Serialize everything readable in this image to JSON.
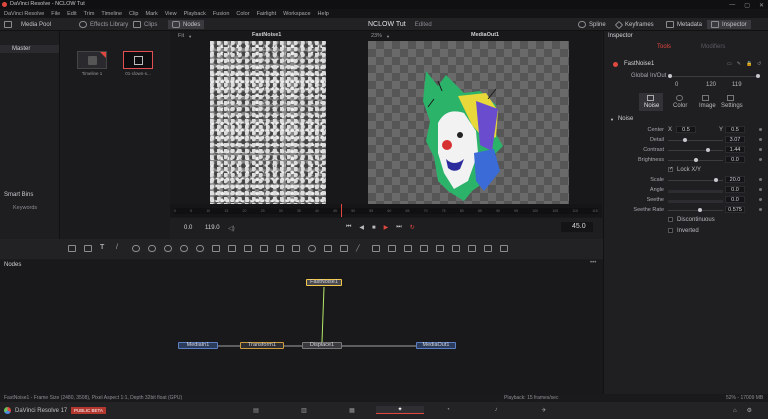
{
  "titlebar": {
    "title": "DaVinci Resolve - NCLOW Tut"
  },
  "menu": [
    "DaVinci Resolve",
    "File",
    "Edit",
    "Trim",
    "Timeline",
    "Clip",
    "Mark",
    "View",
    "Playback",
    "Fusion",
    "Color",
    "Fairlight",
    "Workspace",
    "Help"
  ],
  "toolbar": {
    "media_pool": "Media Pool",
    "effects_library": "Effects Library",
    "clips": "Clips",
    "nodes": "Nodes",
    "project_title": "NCLOW Tut",
    "project_status": "Edited",
    "spline": "Spline",
    "keyframes": "Keyframes",
    "metadata": "Metadata",
    "inspector": "Inspector"
  },
  "media_pool": {
    "master": "Master",
    "smart_bins": "Smart Bins",
    "keywords": "Keywords",
    "clips": [
      {
        "label": "Timeline 1"
      },
      {
        "label": "01-clown-s..."
      }
    ]
  },
  "viewer_left": {
    "fit": "Fit",
    "title": "FastNoise1"
  },
  "viewer_right": {
    "zoom": "23%",
    "title": "MediaOut1"
  },
  "ruler_ticks": [
    "0",
    "5",
    "10",
    "15",
    "20",
    "25",
    "30",
    "35",
    "40",
    "45",
    "50",
    "55",
    "60",
    "65",
    "70",
    "75",
    "80",
    "85",
    "90",
    "95",
    "100",
    "105",
    "110",
    "115"
  ],
  "transport": {
    "start": "0.0",
    "end": "119.0",
    "current_frame": "45.0"
  },
  "inspector": {
    "title": "Inspector",
    "tabs": [
      "Tools",
      "Modifiers"
    ],
    "node_name": "FastNoise1",
    "global_in_out": "Global In/Out",
    "global_values": [
      "0",
      "120",
      "119"
    ],
    "subtabs": [
      "Noise",
      "Color",
      "Image",
      "Settings"
    ],
    "section": "Noise",
    "params": [
      {
        "label": "Center",
        "x_label": "X",
        "x": "0.5",
        "y_label": "Y",
        "y": "0.5"
      },
      {
        "label": "Detail",
        "value": "3.07",
        "fill": 0.31
      },
      {
        "label": "Contrast",
        "value": "1.44",
        "fill": 0.72
      },
      {
        "label": "Brightness",
        "value": "0.0",
        "fill": 0.5
      }
    ],
    "lock_xy": "Lock X/Y",
    "params2": [
      {
        "label": "Scale",
        "value": "20.0",
        "fill": 0.8
      },
      {
        "label": "Angle",
        "value": "0.0",
        "fill": 0.5
      },
      {
        "label": "Seethe",
        "value": "0.0",
        "fill": 0.0
      },
      {
        "label": "Seethe Rate",
        "value": "0.575",
        "fill": 0.58
      }
    ],
    "discontinuous": "Discontinuous",
    "inverted": "Inverted"
  },
  "nodes_panel": {
    "title": "Nodes",
    "items": [
      {
        "label": "FastNoise1"
      },
      {
        "label": "MediaIn1"
      },
      {
        "label": "Transform1"
      },
      {
        "label": "Displace1"
      },
      {
        "label": "MediaOut1"
      }
    ]
  },
  "status": {
    "left": "FastNoise1 - Frame Size (2480, 3508), Pixel Aspect 1:1, Depth 32bit float (GPU)",
    "middle": "Playback: 15 frames/sec",
    "right": "52% - 17009 MB"
  },
  "bottom": {
    "app": "DaVinci Resolve 17",
    "badge": "PUBLIC BETA"
  },
  "colors": {
    "accent": "#e0483f",
    "selected_node": "#f0c84a",
    "link": "#b7e86a"
  }
}
